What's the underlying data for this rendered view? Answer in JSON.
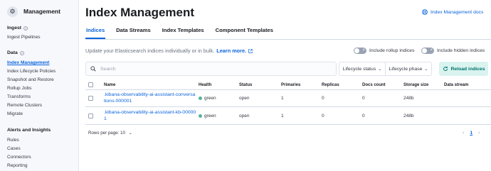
{
  "colors": {
    "accent": "#0b64dd",
    "health_green": "#54b399",
    "reload_bg": "#d9f3ef",
    "reload_text": "#00726b"
  },
  "sidebar": {
    "title": "Management",
    "logo_icon": "gear-icon",
    "sections": [
      {
        "label": "Ingest",
        "items": [
          "Ingest Pipelines"
        ]
      },
      {
        "label": "Data",
        "items": [
          "Index Management",
          "Index Lifecycle Policies",
          "Snapshot and Restore",
          "Rollup Jobs",
          "Transforms",
          "Remote Clusters",
          "Migrate"
        ]
      },
      {
        "label": "Alerts and Insights",
        "items": [
          "Rules",
          "Cases",
          "Connectors",
          "Reporting"
        ]
      }
    ],
    "active_item": "Index Management"
  },
  "header": {
    "title": "Index Management",
    "docs_link": "Index Management docs"
  },
  "tabs": [
    "Indices",
    "Data Streams",
    "Index Templates",
    "Component Templates"
  ],
  "active_tab": "Indices",
  "description": {
    "text": "Update your Elasticsearch indices individually or in bulk.",
    "link": "Learn more."
  },
  "toggles": {
    "rollup": "Include rollup indices",
    "hidden": "Include hidden indices"
  },
  "search": {
    "placeholder": "Search"
  },
  "filters": [
    "Lifecycle status",
    "Lifecycle phase"
  ],
  "reload_button": "Reload indices",
  "table": {
    "columns": [
      "Name",
      "Health",
      "Status",
      "Primaries",
      "Replicas",
      "Docs count",
      "Storage size",
      "Data stream"
    ],
    "rows": [
      {
        "name": ".kibana-observability-ai-assistant-conversations-000001",
        "health": "green",
        "status": "open",
        "primaries": "1",
        "replicas": "0",
        "docs_count": "0",
        "storage_size": "248b",
        "data_stream": ""
      },
      {
        "name": ".kibana-observability-ai-assistant-kb-000001",
        "health": "green",
        "status": "open",
        "primaries": "1",
        "replicas": "0",
        "docs_count": "0",
        "storage_size": "248b",
        "data_stream": ""
      }
    ]
  },
  "footer": {
    "rows_per_page": "Rows per page: 10",
    "current_page": "1"
  }
}
